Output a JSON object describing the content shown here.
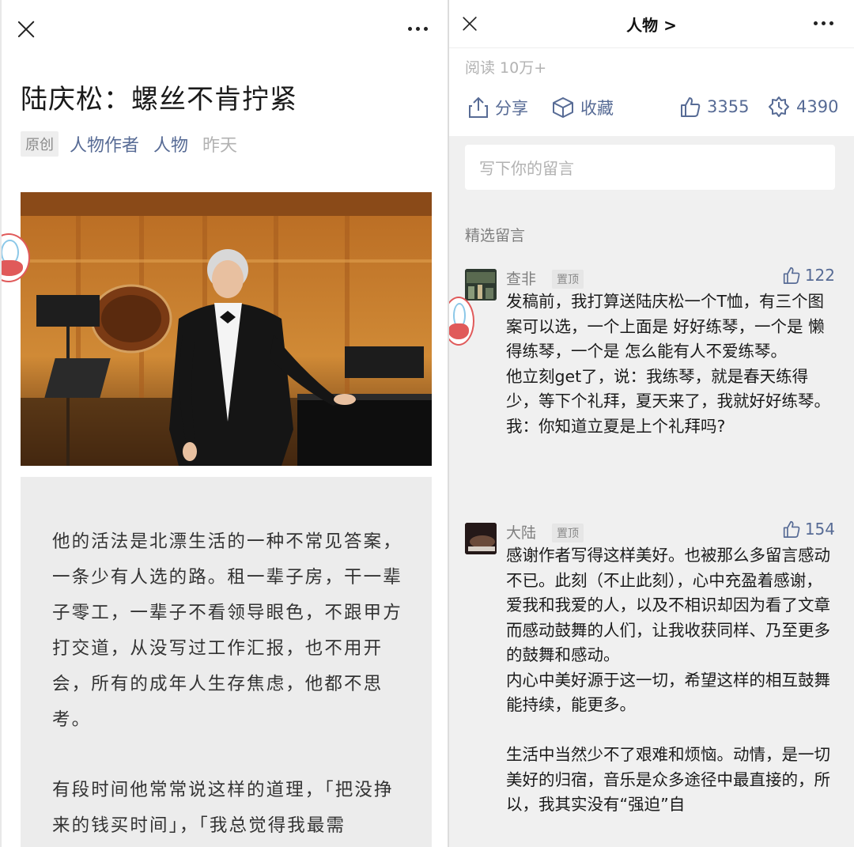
{
  "left": {
    "title": "陆庆松：螺丝不肯拧紧",
    "meta": {
      "original_badge": "原创",
      "author": "人物作者",
      "account": "人物",
      "date": "昨天"
    },
    "paragraphs": [
      "他的活法是北漂生活的一种不常见答案，一条少有人选的路。租一辈子房，干一辈子零工，一辈子不看领导眼色，不跟甲方打交道，从没写过工作汇报，也不用开会，所有的成年人生存焦虑，他都不思考。",
      "有段时间他常常说这样的道理，「把没挣来的钱买时间」，「我总觉得我最需"
    ]
  },
  "right": {
    "header_title": "人物 >",
    "read_count": "阅读 10万+",
    "actions": {
      "share": "分享",
      "favorite": "收藏",
      "like_count": "3355",
      "wow_count": "4390"
    },
    "comment_placeholder": "写下你的留言",
    "featured_label": "精选留言",
    "comments": [
      {
        "name": "查非",
        "pin": "置顶",
        "likes": "122",
        "text": "发稿前，我打算送陆庆松一个T恤，有三个图案可以选，一个上面是 好好练琴，一个是 懒得练琴，一个是 怎么能有人不爱练琴。\n他立刻get了，说：我练琴，就是春天练得少，等下个礼拜，夏天来了，我就好好练琴。\n我：你知道立夏是上个礼拜吗?"
      },
      {
        "name": "大陆",
        "pin": "置顶",
        "likes": "154",
        "text": "感谢作者写得这样美好。也被那么多留言感动不已。此刻（不止此刻），心中充盈着感谢，爱我和我爱的人，以及不相识却因为看了文章而感动鼓舞的人们，让我收获同样、乃至更多的鼓舞和感动。\n内心中美好源于这一切，希望这样的相互鼓舞能持续，能更多。\n\n生活中当然少不了艰难和烦恼。动情，是一切美好的归宿，音乐是众多途径中最直接的，所以，我其实没有“强迫”自"
      }
    ]
  },
  "colors": {
    "link_blue": "#576b95",
    "grey_text": "#b2b2b2",
    "panel_bg": "#f0f0f0"
  }
}
